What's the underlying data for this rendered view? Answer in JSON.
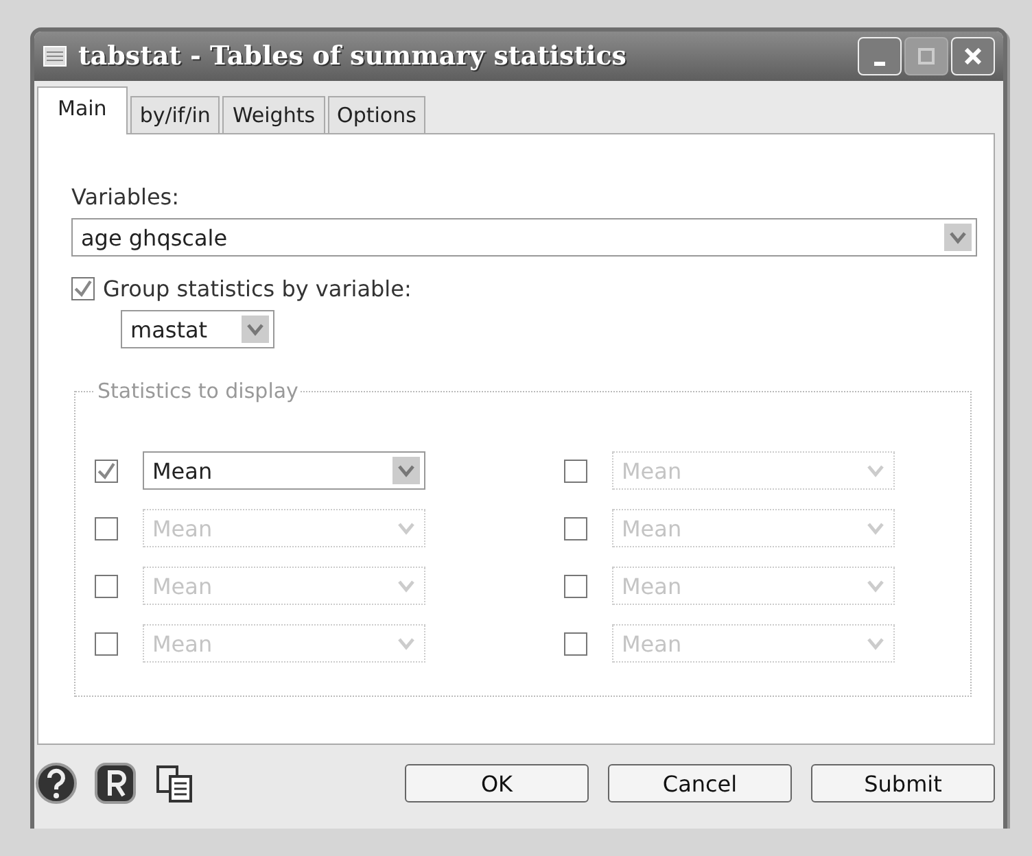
{
  "window": {
    "title": "tabstat - Tables of summary statistics"
  },
  "title_buttons": [
    {
      "kind": "minimize",
      "disabled": false
    },
    {
      "kind": "maximize",
      "disabled": true
    },
    {
      "kind": "close",
      "disabled": false
    }
  ],
  "tabs": [
    {
      "label": "Main",
      "selected": true
    },
    {
      "label": "by/if/in",
      "selected": false
    },
    {
      "label": "Weights",
      "selected": false
    },
    {
      "label": "Options",
      "selected": false
    }
  ],
  "variables": {
    "label": "Variables:",
    "value": "age ghqscale"
  },
  "group_by": {
    "label": "Group statistics by variable:",
    "checked": true,
    "value": "mastat"
  },
  "statistics": {
    "title": "Statistics to display",
    "items": [
      {
        "checked": true,
        "value": "Mean"
      },
      {
        "checked": false,
        "value": "Mean"
      },
      {
        "checked": false,
        "value": "Mean"
      },
      {
        "checked": false,
        "value": "Mean"
      },
      {
        "checked": false,
        "value": "Mean"
      },
      {
        "checked": false,
        "value": "Mean"
      },
      {
        "checked": false,
        "value": "Mean"
      },
      {
        "checked": false,
        "value": "Mean"
      }
    ]
  },
  "footer_icons": [
    {
      "kind": "help"
    },
    {
      "kind": "reset"
    },
    {
      "kind": "copy"
    }
  ],
  "buttons": [
    "OK",
    "Cancel",
    "Submit"
  ]
}
